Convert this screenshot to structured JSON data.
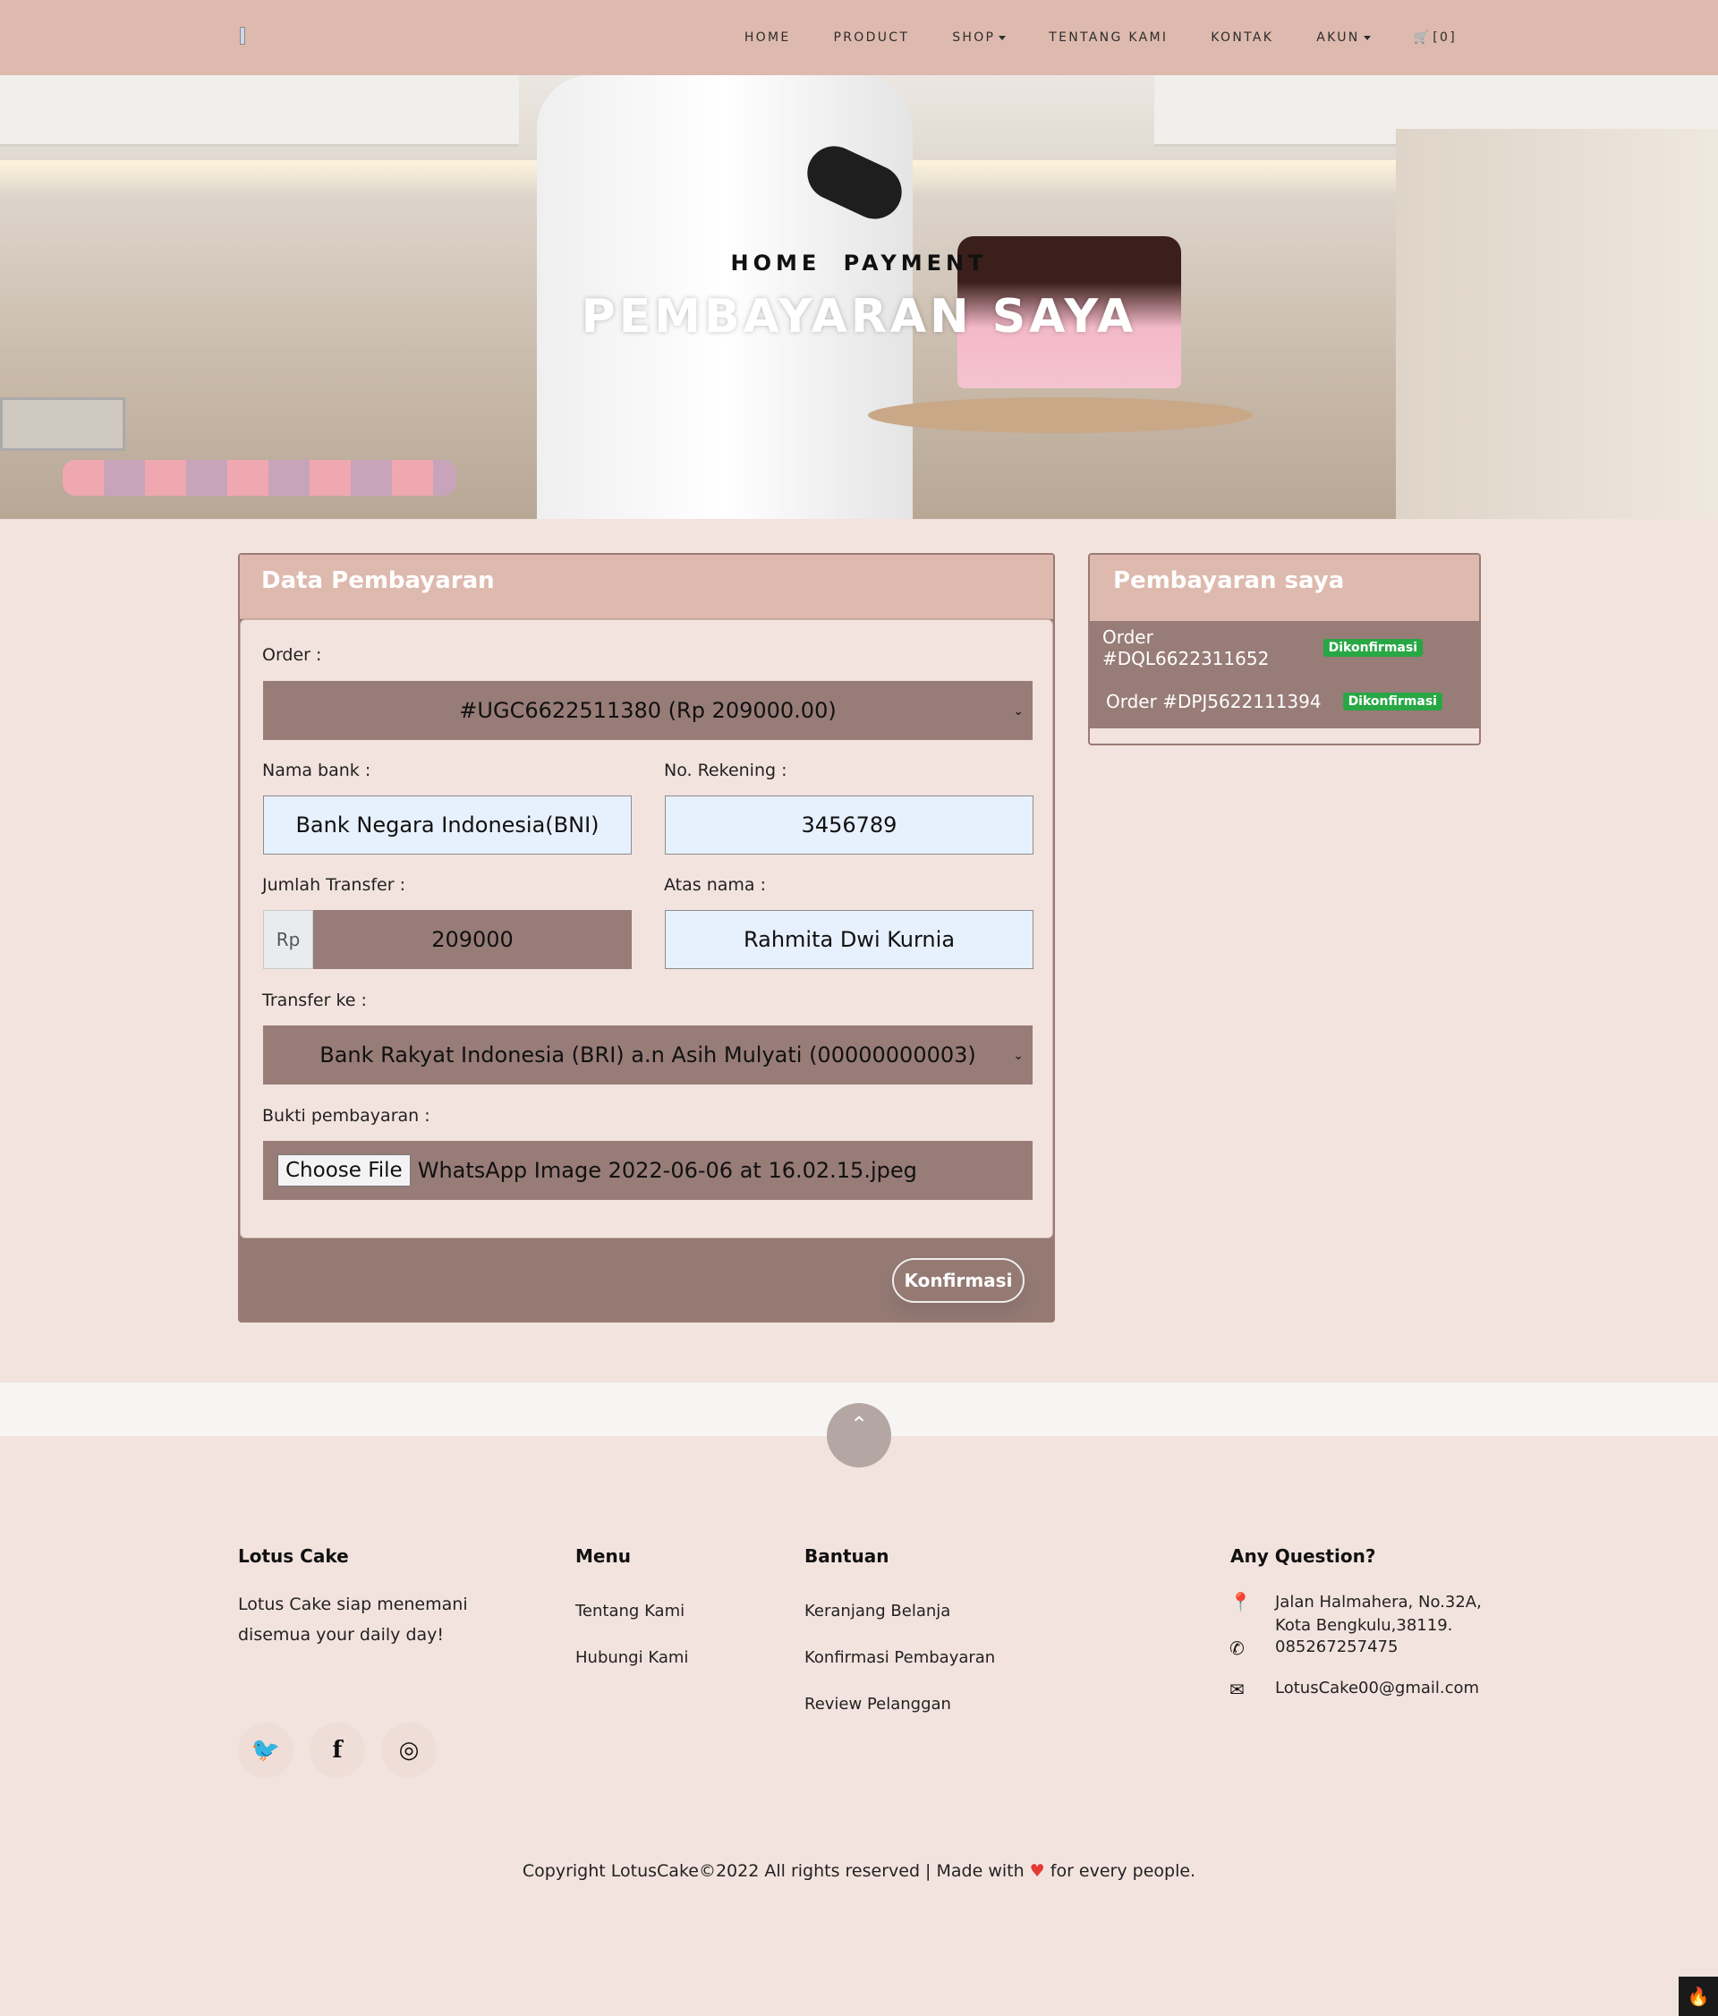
{
  "nav": {
    "items": [
      {
        "label": "HOME"
      },
      {
        "label": "PRODUCT"
      },
      {
        "label": "SHOP"
      },
      {
        "label": "TENTANG KAMI"
      },
      {
        "label": "KONTAK"
      },
      {
        "label": "AKUN"
      }
    ],
    "cart_label": "[0]"
  },
  "hero": {
    "crumb_home": "HOME",
    "crumb_page": "PAYMENT",
    "title": "PEMBAYARAN SAYA"
  },
  "form": {
    "title": "Data Pembayaran",
    "order_label": "Order :",
    "order_value": "#UGC6622511380 (Rp 209000.00)",
    "bank_label": "Nama bank :",
    "bank_value": "Bank Negara Indonesia(BNI)",
    "rek_label": "No. Rekening :",
    "rek_value": "3456789",
    "amount_label": "Jumlah Transfer :",
    "amount_prefix": "Rp",
    "amount_value": "209000",
    "name_label": "Atas nama :",
    "name_value": "Rahmita Dwi Kurnia",
    "transfer_label": "Transfer ke :",
    "transfer_value": "Bank Rakyat Indonesia (BRI) a.n Asih Mulyati (00000000003)",
    "proof_label": "Bukti pembayaran :",
    "file_button": "Choose File",
    "file_name": "WhatsApp Image 2022-06-06 at 16.02.15.jpeg",
    "submit_label": "Konfirmasi"
  },
  "side": {
    "title": "Pembayaran saya",
    "orders": [
      {
        "label": "Order #DQL6622311652",
        "status": "Dikonfirmasi"
      },
      {
        "label": "Order #DPJ5622111394",
        "status": "Dikonfirmasi"
      }
    ]
  },
  "footer": {
    "about_title": "Lotus Cake",
    "about_line1": "Lotus Cake siap menemani",
    "about_line2": "disemua your daily day!",
    "menu_title": "Menu",
    "menu_links": [
      "Tentang Kami",
      "Hubungi Kami"
    ],
    "help_title": "Bantuan",
    "help_links": [
      "Keranjang Belanja",
      "Konfirmasi Pembayaran",
      "Review Pelanggan"
    ],
    "contact_title": "Any Question?",
    "address_line1": "Jalan Halmahera, No.32A,",
    "address_line2": "Kota Bengkulu,38119.",
    "phone": "085267257475",
    "email": "LotusCake00@gmail.com",
    "copyright_pre": "Copyright LotusCake©2022 All rights reserved | Made with",
    "copyright_post": "for every people."
  },
  "icons": {
    "cart": "cart-icon",
    "back_to_top": "chevron-up-icon",
    "twitter": "twitter-icon",
    "facebook": "facebook-icon",
    "instagram": "instagram-icon",
    "map": "map-marker-icon",
    "phone": "phone-icon",
    "email": "envelope-icon"
  },
  "colors": {
    "nav_bg": "#deb9ad",
    "page_bg": "#f3e3de",
    "accent": "#987c77",
    "badge": "#28a745"
  }
}
